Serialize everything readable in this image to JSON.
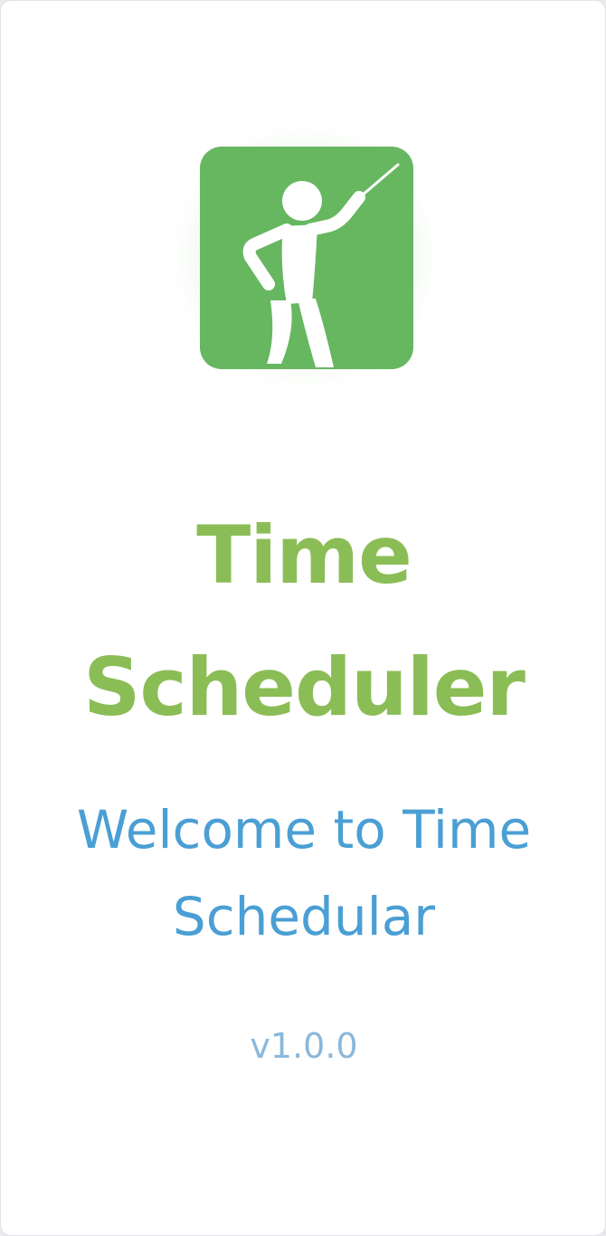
{
  "app": {
    "title_line1": "Time",
    "title_line2": "Scheduler",
    "welcome_message": "Welcome to Time Schedular",
    "version": "v1.0.0",
    "logo_icon": "teacher-with-pointer-icon"
  },
  "colors": {
    "title": "#8bbd56",
    "welcome": "#4a9fd4",
    "version": "#8ab8dc",
    "logo_background": "#67b761"
  }
}
